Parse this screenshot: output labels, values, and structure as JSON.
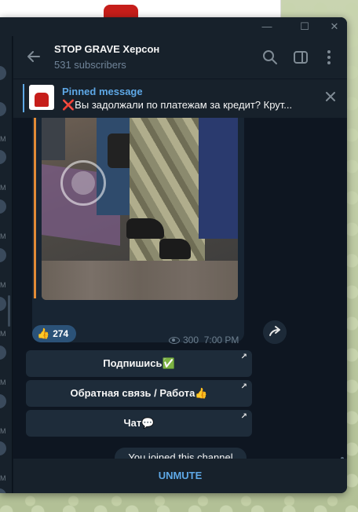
{
  "window": {
    "minimize_icon": "minimize-icon",
    "maximize_icon": "maximize-icon",
    "close_icon": "close-icon"
  },
  "header": {
    "title": "STOP GRAVE Херсон",
    "subtitle": "531 subscribers"
  },
  "pinned": {
    "label": "Pinned message",
    "text": "❌Вы задолжали по платежам за кредит? Крут..."
  },
  "sidebar": {
    "letters": [
      "M",
      "M",
      "M",
      "M",
      "M",
      "M",
      "M",
      "M"
    ]
  },
  "message": {
    "reaction_emoji": "👍",
    "reaction_count": "274",
    "views": "300",
    "time": "7:00 PM"
  },
  "buttons": [
    {
      "label": "Подпишись✅"
    },
    {
      "label": "Обратная связь / Работа👍"
    },
    {
      "label": "Чат💬"
    }
  ],
  "service": {
    "joined": "You joined this channel"
  },
  "footer": {
    "action": "UNMUTE"
  },
  "colors": {
    "accent": "#5ea8e6",
    "bg": "#0e1621",
    "panel": "#17212b"
  }
}
